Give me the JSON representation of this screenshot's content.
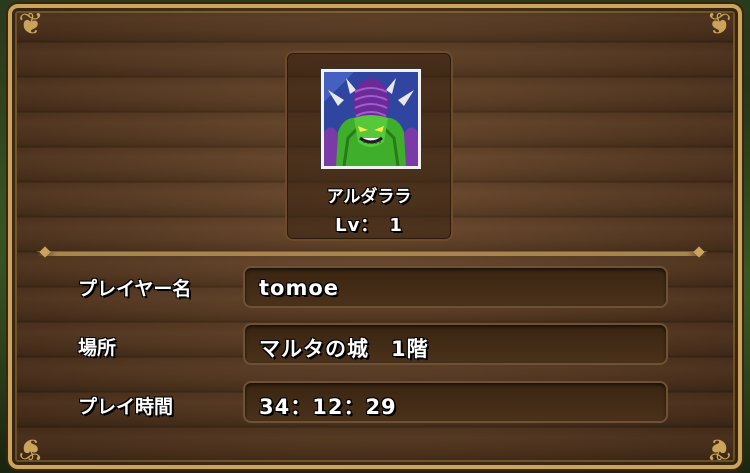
{
  "monster": {
    "name": "アルダララ",
    "level_label": "Lv：　1",
    "portrait_icon": "green-demon-portrait-icon"
  },
  "info_rows": [
    {
      "label": "プレイヤー名",
      "value": "tomoe"
    },
    {
      "label": "場所",
      "value": "マルタの城　1階"
    },
    {
      "label": "プレイ時間",
      "value": "34：12：29"
    }
  ],
  "colors": {
    "frame_gold": "#c9a45a",
    "wood": "#5a3a22",
    "portrait_bg": "#3c4fa8"
  }
}
